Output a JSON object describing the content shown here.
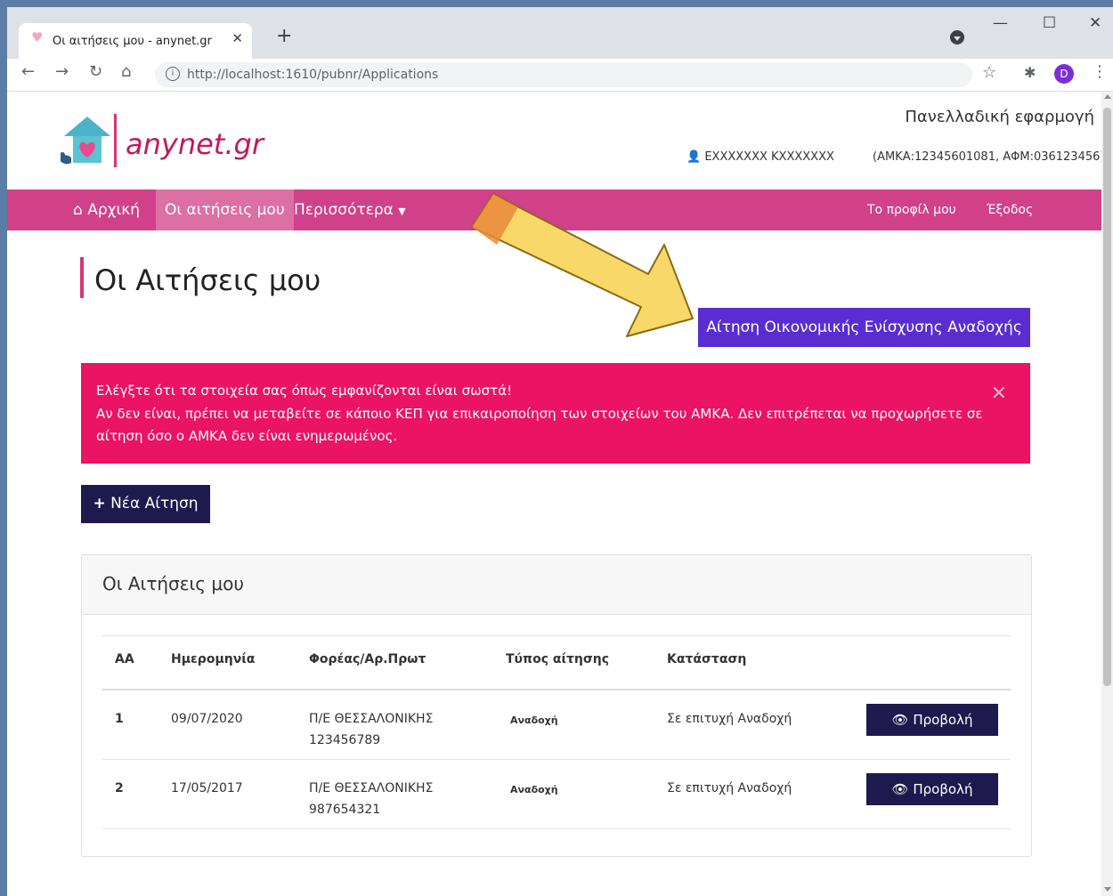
{
  "browser": {
    "tab_title": "Οι αιτήσεις μου - anynet.gr",
    "url": "http://localhost:1610/pubnr/Applications",
    "profile_initial": "D"
  },
  "header": {
    "logo_text": "anynet.gr",
    "app_name": "Πανελλαδική εφαρμογή",
    "user_name": "EXXXXXXX KXXXXXXX",
    "user_ids": "(ΑΜΚΑ:12345601081, ΑΦΜ:036123456)"
  },
  "nav": {
    "home": "Αρχική",
    "my_applications": "Οι αιτήσεις μου",
    "more": "Περισσότερα",
    "profile": "Το προφίλ μου",
    "logout": "Έξοδος"
  },
  "page": {
    "title": "Οι Αιτήσεις μου",
    "primary_button": "Αίτηση Οικονομικής Ενίσχυσης Αναδοχής",
    "new_button": "Νέα Αίτηση"
  },
  "alert": {
    "line1": "Ελέγξτε ότι τα στοιχεία σας όπως εμφανίζονται είναι σωστά!",
    "line2": "Αν δεν είναι, πρέπει να μεταβείτε σε κάποιο ΚΕΠ για επικαιροποίηση των στοιχείων του ΑΜΚΑ. Δεν επιτρέπεται να προχωρήσετε σε",
    "line3": "αίτηση όσο ο ΑΜΚΑ δεν είναι ενημερωμένος."
  },
  "table": {
    "card_title": "Οι Αιτήσεις μου",
    "headers": [
      "ΑΑ",
      "Ημερομηνία",
      "Φορέας/Αρ.Πρωτ",
      "Τύπος αίτησης",
      "Κατάσταση"
    ],
    "rows": [
      {
        "aa": "1",
        "date": "09/07/2020",
        "agency": "Π/Ε ΘΕΣΣΑΛΟΝΙΚΗΣ",
        "protocol": "123456789",
        "type": "Αναδοχή",
        "status": "Σε επιτυχή Αναδοχή",
        "action": "Προβολή"
      },
      {
        "aa": "2",
        "date": "17/05/2017",
        "agency": "Π/Ε ΘΕΣΣΑΛΟΝΙΚΗΣ",
        "protocol": "987654321",
        "type": "Αναδοχή",
        "status": "Σε επιτυχή Αναδοχή",
        "action": "Προβολή"
      }
    ]
  },
  "colors": {
    "brand_pink": "#d0418a",
    "alert": "#ea1364",
    "primary_button": "#5a2dd3",
    "dark_button": "#1e1a4d",
    "arrow_fill": "#f9d86a"
  }
}
